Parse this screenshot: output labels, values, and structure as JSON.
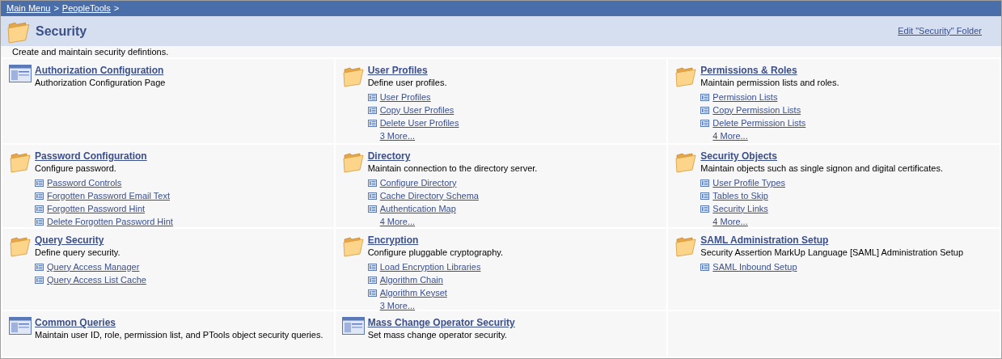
{
  "breadcrumb": [
    "Main Menu",
    "PeopleTools"
  ],
  "breadcrumb_separator": ">",
  "page_title": "Security",
  "edit_link": "Edit \"Security\" Folder",
  "description": "Create and maintain security defintions.",
  "tiles": [
    {
      "kind": "page",
      "title": "Authorization Configuration",
      "description": "Authorization Configuration Page"
    },
    {
      "kind": "folder",
      "title": "User Profiles",
      "description": "Define user profiles.",
      "links": [
        "User Profiles",
        "Copy User Profiles",
        "Delete User Profiles"
      ],
      "more": "3 More..."
    },
    {
      "kind": "folder",
      "title": "Permissions & Roles",
      "description": "Maintain permission lists and roles.",
      "links": [
        "Permission Lists",
        "Copy Permission Lists",
        "Delete Permission Lists"
      ],
      "more": "4 More..."
    },
    {
      "kind": "folder",
      "title": "Password Configuration",
      "description": "Configure password.",
      "links": [
        "Password Controls",
        "Forgotten Password Email Text",
        "Forgotten Password Hint",
        "Delete Forgotten Password Hint"
      ]
    },
    {
      "kind": "folder",
      "title": "Directory",
      "description": "Maintain connection to the directory server.",
      "links": [
        "Configure Directory",
        "Cache Directory Schema",
        "Authentication Map"
      ],
      "more": "4 More..."
    },
    {
      "kind": "folder",
      "title": "Security Objects",
      "description": "Maintain objects such as single signon and digital certificates.",
      "links": [
        "User Profile Types",
        "Tables to Skip",
        "Security Links"
      ],
      "more": "4 More..."
    },
    {
      "kind": "folder",
      "title": "Query Security",
      "description": "Define query security.",
      "links": [
        "Query Access Manager",
        "Query Access List Cache"
      ]
    },
    {
      "kind": "folder",
      "title": "Encryption",
      "description": "Configure pluggable cryptography.",
      "links": [
        "Load Encryption Libraries",
        "Algorithm Chain",
        "Algorithm Keyset"
      ],
      "more": "3 More..."
    },
    {
      "kind": "folder",
      "title": "SAML Administration Setup",
      "description": "Security Assertion MarkUp Language [SAML] Administration Setup",
      "links": [
        "SAML Inbound Setup"
      ]
    },
    {
      "kind": "page",
      "title": "Common Queries",
      "description": "Maintain user ID, role, permission list, and PTools object security queries."
    },
    {
      "kind": "page",
      "title": "Mass Change Operator Security",
      "description": "Set mass change operator security."
    }
  ]
}
